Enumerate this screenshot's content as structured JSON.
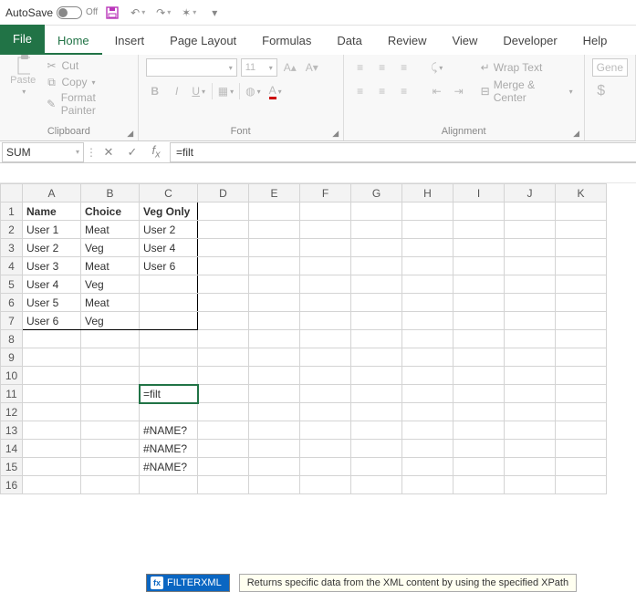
{
  "titlebar": {
    "autosave_label": "AutoSave",
    "autosave_state": "Off"
  },
  "tabs": {
    "file": "File",
    "items": [
      "Home",
      "Insert",
      "Page Layout",
      "Formulas",
      "Data",
      "Review",
      "View",
      "Developer",
      "Help"
    ],
    "active": "Home"
  },
  "ribbon": {
    "clipboard": {
      "label": "Clipboard",
      "paste": "Paste",
      "cut": "Cut",
      "copy": "Copy",
      "format_painter": "Format Painter"
    },
    "font": {
      "label": "Font",
      "size": "11",
      "bold": "B",
      "italic": "I",
      "underline": "U"
    },
    "alignment": {
      "label": "Alignment",
      "wrap": "Wrap Text",
      "merge": "Merge & Center"
    },
    "number": {
      "general": "Gene",
      "dollar": "$"
    }
  },
  "namebox": "SUM",
  "formula": "=filt",
  "columns": [
    "A",
    "B",
    "C",
    "D",
    "E",
    "F",
    "G",
    "H",
    "I",
    "J",
    "K"
  ],
  "rows": [
    "1",
    "2",
    "3",
    "4",
    "5",
    "6",
    "7",
    "8",
    "9",
    "10",
    "11",
    "12",
    "13",
    "14",
    "15",
    "16"
  ],
  "cells": {
    "A1": "Name",
    "B1": "Choice",
    "C1": "Veg Only",
    "A2": "User 1",
    "B2": "Meat",
    "C2": "User 2",
    "A3": "User 2",
    "B3": "Veg",
    "C3": "User 4",
    "A4": "User 3",
    "B4": "Meat",
    "C4": "User 6",
    "A5": "User 4",
    "B5": "Veg",
    "A6": "User 5",
    "B6": "Meat",
    "A7": "User 6",
    "B7": "Veg",
    "C11": "=filt",
    "C12": " ",
    "C13": "#NAME?",
    "C14": "#NAME?",
    "C15": "#NAME?"
  },
  "autocomplete": {
    "fn": "FILTERXML",
    "desc": "Returns specific data from the XML content by using the specified XPath"
  }
}
